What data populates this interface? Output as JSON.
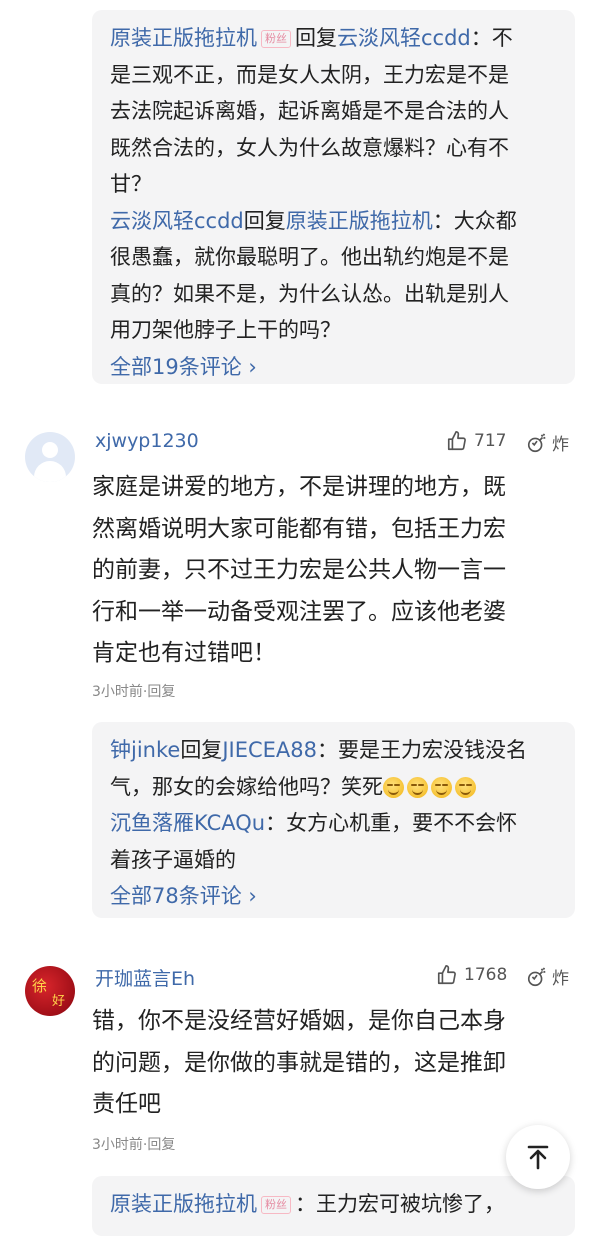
{
  "thread1": {
    "replies": [
      {
        "user": "原装正版拖拉机",
        "badge": "粉丝",
        "reply_word": "回复",
        "target": "云淡风轻ccdd",
        "lines": [
          "：不",
          "是三观不正，而是女人太阴，王力宏是不是",
          "去法院起诉离婚，起诉离婚是不是合法的人",
          "既然合法的，女人为什么故意爆料？心有不",
          "甘？"
        ]
      },
      {
        "user": "云淡风轻ccdd",
        "reply_word": "回复",
        "target": "原装正版拖拉机",
        "lines": [
          "：大众都",
          "很愚蠢，就你最聪明了。他出轨约炮是不是",
          "真的？如果不是，为什么认怂。出轨是别人",
          "用刀架他脖子上干的吗？"
        ]
      }
    ],
    "more": "全部19条评论 ›"
  },
  "comment1": {
    "username": "xjwyp1230",
    "likes": "717",
    "react_label": "炸",
    "lines": [
      "家庭是讲爱的地方，不是讲理的地方，既",
      "然离婚说明大家可能都有错，包括王力宏",
      "的前妻，只不过王力宏是公共人物一言一",
      "行和一举一动备受观注罢了。应该他老婆",
      "肯定也有过错吧！"
    ],
    "time": "3小时前",
    "reply": "·回复"
  },
  "thread2": {
    "replies": [
      {
        "user": "钟jinke",
        "reply_word": "回复",
        "target": "JIECEA88",
        "lines": [
          "：要是王力宏没钱没名",
          "气，那女的会嫁给他吗？笑死"
        ]
      },
      {
        "user": "沉鱼落雁KCAQu",
        "lines": [
          "：女方心机重，要不不会怀",
          "着孩子逼婚的"
        ]
      }
    ],
    "more": "全部78条评论 ›"
  },
  "comment2": {
    "username": "开珈蓝言Eh",
    "likes": "1768",
    "react_label": "炸",
    "avatar_text_1": "徐",
    "avatar_text_2": "好",
    "lines": [
      "错，你不是没经营好婚姻，是你自己本身",
      "的问题，是你做的事就是错的，这是推卸",
      "责任吧"
    ],
    "time": "3小时前",
    "reply": "·回复"
  },
  "thread3": {
    "user": "原装正版拖拉机",
    "badge": "粉丝",
    "text": "：王力宏可被坑惨了，"
  },
  "icons": {
    "like": "thumbs-up-icon",
    "react": "bomb-icon",
    "back_to_top": "arrow-up-icon"
  },
  "colors": {
    "username": "#3f69a9",
    "reply_bg": "#f4f4f5",
    "text": "#222222",
    "meta": "#888888"
  }
}
